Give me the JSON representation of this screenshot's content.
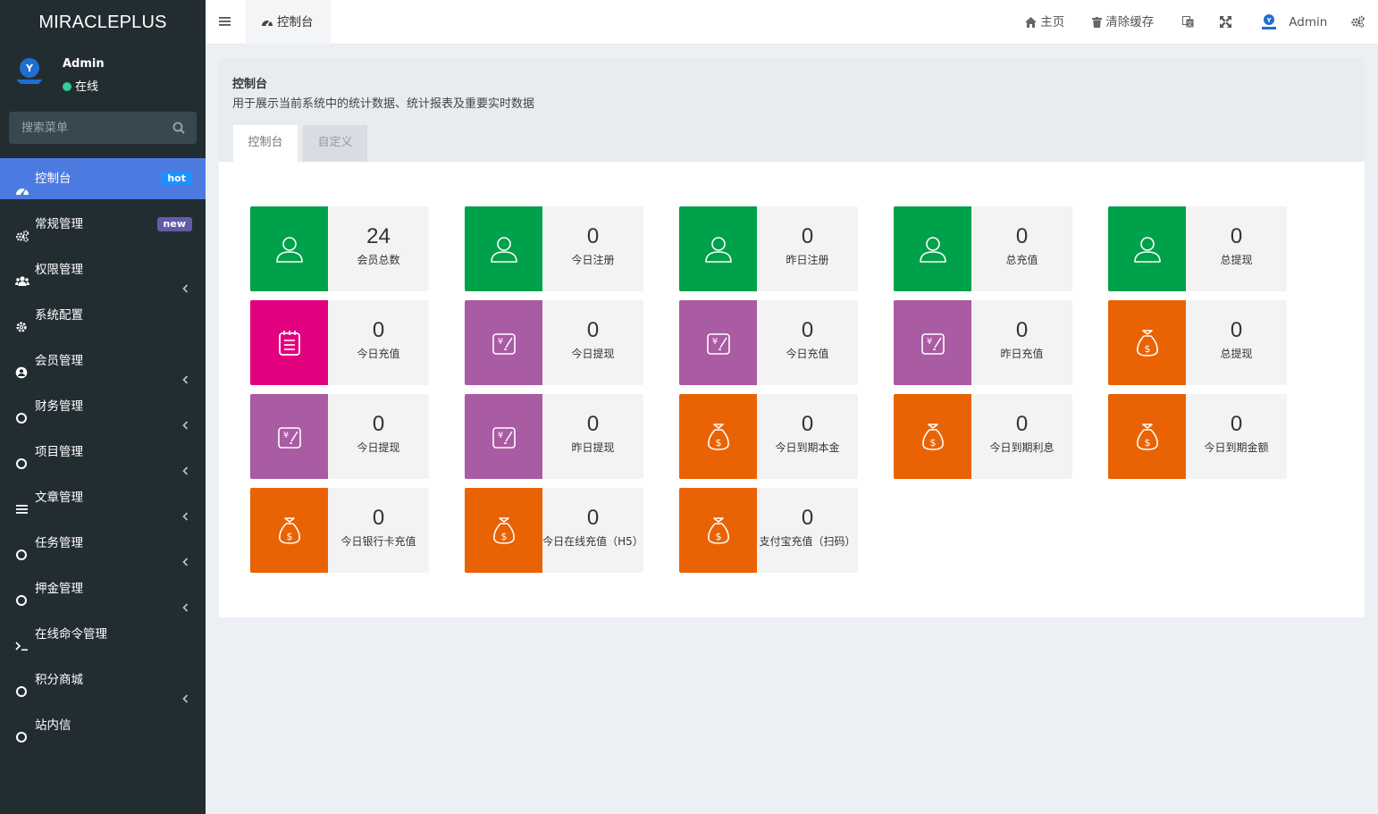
{
  "sidebar": {
    "brand": "MIRACLEPLUS",
    "user": {
      "name": "Admin",
      "status": "在线"
    },
    "search": {
      "placeholder": "搜索菜单"
    },
    "items": [
      {
        "label": "控制台",
        "icon": "dashboard-icon",
        "badge": "hot",
        "active": true
      },
      {
        "label": "常规管理",
        "icon": "cogs-icon",
        "badge": "new"
      },
      {
        "label": "权限管理",
        "icon": "users-icon",
        "expandable": true
      },
      {
        "label": "系统配置",
        "icon": "gear-icon"
      },
      {
        "label": "会员管理",
        "icon": "user-circle-icon",
        "expandable": true
      },
      {
        "label": "财务管理",
        "icon": "circle-icon",
        "expandable": true
      },
      {
        "label": "项目管理",
        "icon": "circle-icon",
        "expandable": true
      },
      {
        "label": "文章管理",
        "icon": "list-icon",
        "expandable": true
      },
      {
        "label": "任务管理",
        "icon": "circle-icon",
        "expandable": true
      },
      {
        "label": "押金管理",
        "icon": "circle-icon",
        "expandable": true
      },
      {
        "label": "在线命令管理",
        "icon": "terminal-icon"
      },
      {
        "label": "积分商城",
        "icon": "circle-icon",
        "expandable": true
      },
      {
        "label": "站内信",
        "icon": "circle-icon"
      }
    ]
  },
  "topbar": {
    "tab_label": "控制台",
    "home": "主页",
    "clear_cache": "清除缓存",
    "user": "Admin"
  },
  "content": {
    "title": "控制台",
    "description": "用于展示当前系统中的统计数据、统计报表及重要实时数据",
    "tabs": [
      "控制台",
      "自定义"
    ]
  },
  "colors": {
    "green": "#00a14b",
    "pink": "#e3007f",
    "purple": "#a95ba3",
    "orange": "#e96305",
    "sidebar": "#222d32",
    "active": "#4c7ae0"
  },
  "stats": [
    {
      "value": "24",
      "label": "会员总数",
      "color": "green",
      "icon": "user-icon"
    },
    {
      "value": "0",
      "label": "今日注册",
      "color": "green",
      "icon": "user-icon"
    },
    {
      "value": "0",
      "label": "昨日注册",
      "color": "green",
      "icon": "user-icon"
    },
    {
      "value": "0",
      "label": "总充值",
      "color": "green",
      "icon": "user-icon"
    },
    {
      "value": "0",
      "label": "总提现",
      "color": "green",
      "icon": "user-icon"
    },
    {
      "value": "0",
      "label": "今日充值",
      "color": "pink",
      "icon": "notepad-icon"
    },
    {
      "value": "0",
      "label": "今日提现",
      "color": "purple",
      "icon": "yuan-card-icon"
    },
    {
      "value": "0",
      "label": "今日充值",
      "color": "purple",
      "icon": "yuan-card-icon"
    },
    {
      "value": "0",
      "label": "昨日充值",
      "color": "purple",
      "icon": "yuan-card-icon"
    },
    {
      "value": "0",
      "label": "总提现",
      "color": "orange",
      "icon": "money-bag-icon"
    },
    {
      "value": "0",
      "label": "今日提现",
      "color": "purple",
      "icon": "yuan-card-icon"
    },
    {
      "value": "0",
      "label": "昨日提现",
      "color": "purple",
      "icon": "yuan-card-icon"
    },
    {
      "value": "0",
      "label": "今日到期本金",
      "color": "orange",
      "icon": "money-bag-icon"
    },
    {
      "value": "0",
      "label": "今日到期利息",
      "color": "orange",
      "icon": "money-bag-icon"
    },
    {
      "value": "0",
      "label": "今日到期金额",
      "color": "orange",
      "icon": "money-bag-icon"
    },
    {
      "value": "0",
      "label": "今日银行卡充值",
      "color": "orange",
      "icon": "money-bag-icon"
    },
    {
      "value": "0",
      "label": "今日在线充值（H5）",
      "color": "orange",
      "icon": "money-bag-icon"
    },
    {
      "value": "0",
      "label": "支付宝充值（扫码）",
      "color": "orange",
      "icon": "money-bag-icon"
    }
  ]
}
